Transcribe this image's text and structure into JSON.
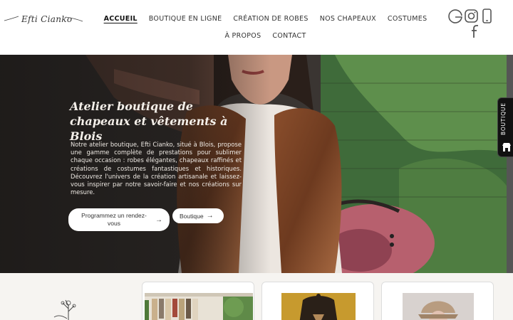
{
  "brand": {
    "logo_text": "Efti Cianko"
  },
  "nav": {
    "row1": [
      "ACCUEIL",
      "BOUTIQUE EN LIGNE",
      "CRÉATION DE ROBES",
      "NOS CHAPEAUX",
      "COSTUMES"
    ],
    "row2": [
      "À PROPOS",
      "CONTACT"
    ],
    "active": "ACCUEIL"
  },
  "social": {
    "icons": [
      "google-icon",
      "instagram-icon",
      "phone-icon",
      "facebook-icon"
    ]
  },
  "hero": {
    "title": "Atelier boutique de chapeaux et vêtements à Blois",
    "text": "Notre atelier boutique, Efti Cianko, situé à Blois, propose une gamme complète de prestations pour sublimer chaque occasion : robes élégantes, chapeaux raffinés et créations de costumes fantastiques et historiques. Découvrez l'univers de la création artisanale et laissez-vous inspirer par notre savoir-faire et nos créations sur mesure.",
    "btn_rdv": "Programmez un rendez-vous",
    "btn_boutique": "Boutique",
    "arrow": "→"
  },
  "side_tab": {
    "label": "BOUTIQUE"
  },
  "colors": {
    "hero_overlay": "#141211",
    "button_bg": "#ffffff",
    "side_tab_bg": "#111111",
    "strip_bg": "#f6f4f1"
  }
}
